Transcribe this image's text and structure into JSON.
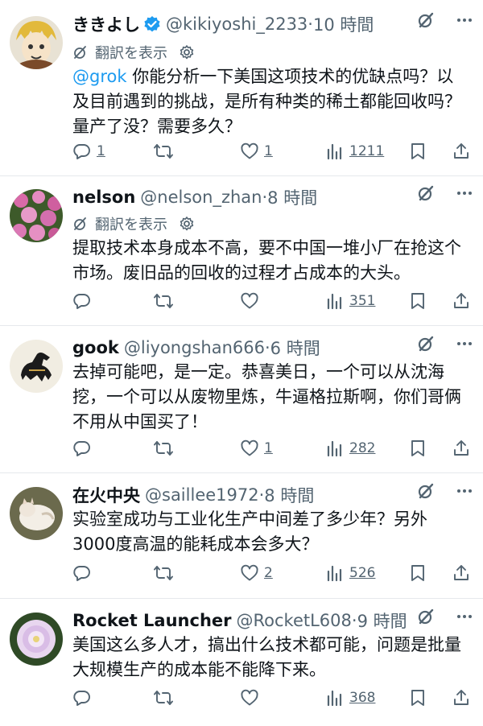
{
  "translate_label": "翻訳を表示",
  "posts": [
    {
      "name": "ききよし",
      "handle": "@kikiyoshi_2233",
      "sep": "·",
      "time": "10 時間",
      "verified": true,
      "show_translate": true,
      "mention": "@grok",
      "text": " 你能分析一下美国这项技术的优缺点吗？以及目前遇到的挑战，是所有种类的稀土都能回收吗？量产了没？需要多久？",
      "replies": "1",
      "retweets": "",
      "likes": "1",
      "views": "1211"
    },
    {
      "name": "nelson",
      "handle": "@nelson_zhan",
      "sep": "·",
      "time": "8 時間",
      "verified": false,
      "show_translate": true,
      "mention": "",
      "text": "提取技术本身成本不高，要不中国一堆小厂在抢这个市场。废旧品的回收的过程才占成本的大头。",
      "replies": "",
      "retweets": "",
      "likes": "",
      "views": "351"
    },
    {
      "name": "gook",
      "handle": "@liyongshan666",
      "sep": "·",
      "time": "6 時間",
      "verified": false,
      "show_translate": false,
      "mention": "",
      "text": "去掉可能吧，是一定。恭喜美日，一个可以从沈海挖，一个可以从废物里炼，牛逼格拉斯啊，你们哥俩不用从中国买了！",
      "replies": "",
      "retweets": "",
      "likes": "1",
      "views": "282"
    },
    {
      "name": "在火中央",
      "handle": "@saillee1972",
      "sep": "·",
      "time": "8 時間",
      "verified": false,
      "show_translate": false,
      "mention": "",
      "text": "实验室成功与工业化生产中间差了多少年？另外3000度高温的能耗成本会多大？",
      "replies": "",
      "retweets": "",
      "likes": "2",
      "views": "526"
    },
    {
      "name": "Rocket Launcher",
      "handle": "@RocketL608",
      "sep": "·",
      "time": "9 時間",
      "verified": false,
      "show_translate": false,
      "mention": "",
      "text": "美国这么多人才，搞出什么技术都可能，问题是批量大规模生产的成本能不能降下来。",
      "replies": "",
      "retweets": "",
      "likes": "",
      "views": "368"
    }
  ],
  "colors": {
    "accent": "#1d9bf0",
    "muted": "#536471",
    "text": "#0f1419",
    "divider": "#e6e9ec"
  },
  "icons": [
    "verified-badge-icon",
    "grok-icon",
    "more-icon",
    "translate-icon",
    "gear-icon",
    "reply-icon",
    "retweet-icon",
    "like-icon",
    "views-icon",
    "bookmark-icon",
    "share-icon"
  ]
}
